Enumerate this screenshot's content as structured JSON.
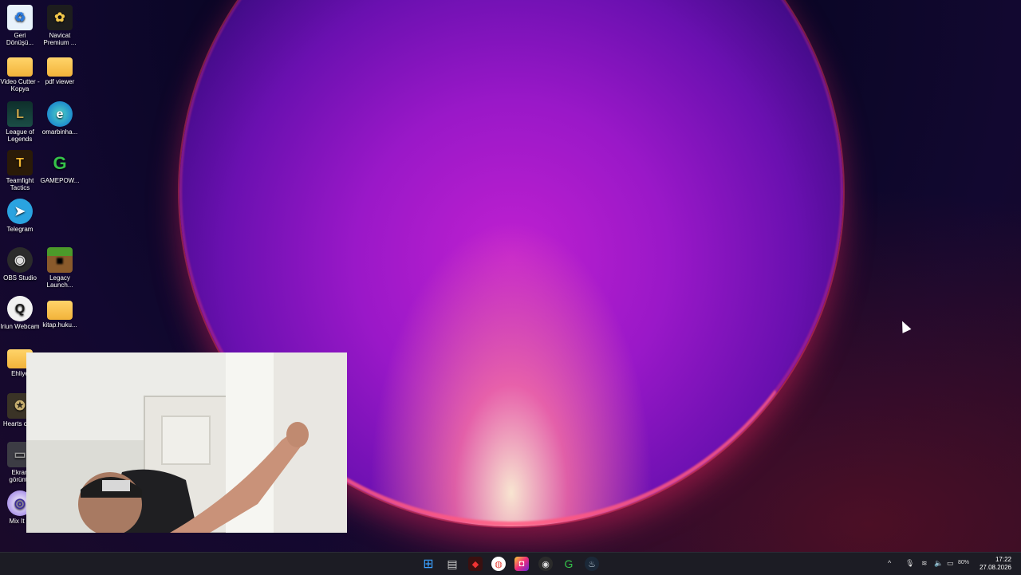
{
  "desktop": {
    "icons": [
      {
        "label": "Geri Dönüşü...",
        "icon": "recycle-bin-icon",
        "glyph": "♻"
      },
      {
        "label": "Navicat Premium ...",
        "icon": "navicat-icon",
        "glyph": "✿"
      },
      {
        "label": "Video Cutter - Kopya",
        "icon": "folder-icon",
        "glyph": ""
      },
      {
        "label": "pdf viewer",
        "icon": "folder-icon",
        "glyph": ""
      },
      {
        "label": "League of Legends",
        "icon": "league-of-legends-icon",
        "glyph": "L"
      },
      {
        "label": "omarbinha...",
        "icon": "edge-icon",
        "glyph": "e"
      },
      {
        "label": "Teamfight Tactics",
        "icon": "teamfight-tactics-icon",
        "glyph": "T"
      },
      {
        "label": "GAMEPOW...",
        "icon": "gamepower-icon",
        "glyph": "G"
      },
      {
        "label": "Telegram",
        "icon": "telegram-icon",
        "glyph": "➤"
      },
      {
        "label": "OBS Studio",
        "icon": "obs-icon",
        "glyph": "◉"
      },
      {
        "label": "Legacy Launch...",
        "icon": "minecraft-icon",
        "glyph": "■"
      },
      {
        "label": "Iriun Webcam",
        "icon": "iriun-webcam-icon",
        "glyph": "Q"
      },
      {
        "label": "kitap.huku...",
        "icon": "folder-icon",
        "glyph": ""
      },
      {
        "label": "Ehliye",
        "icon": "folder-icon",
        "glyph": ""
      },
      {
        "label": "Hearts of IV",
        "icon": "hearts-of-iron-icon",
        "glyph": "✪"
      },
      {
        "label": "Ekran görüntü",
        "icon": "screenshot-file-icon",
        "glyph": "▭"
      },
      {
        "label": "Mix It U",
        "icon": "mix-it-up-icon",
        "glyph": "◎"
      }
    ]
  },
  "taskbar": {
    "apps": [
      {
        "name": "start-icon",
        "glyph": "⊞",
        "color": "#3aa0ff"
      },
      {
        "name": "file-explorer-icon",
        "glyph": "▤",
        "color": "#cfcfcf"
      },
      {
        "name": "app-red-icon",
        "glyph": "◆",
        "color": "#d33"
      },
      {
        "name": "chrome-icon",
        "glyph": "◍",
        "color": "#e8453c"
      },
      {
        "name": "instagram-icon",
        "glyph": "◘",
        "color": "#d6307a"
      },
      {
        "name": "obs-taskbar-icon",
        "glyph": "◉",
        "color": "#555"
      },
      {
        "name": "gamepower-taskbar-icon",
        "glyph": "G",
        "color": "#2a8a3a"
      },
      {
        "name": "steam-icon",
        "glyph": "♨",
        "color": "#1b2838"
      }
    ],
    "tray": {
      "battery": "80%",
      "time": "17:22",
      "date": "27.08.2026"
    }
  },
  "colors": {
    "taskbar_bg": "#1c1c24",
    "accent": "#3aa0ff"
  }
}
